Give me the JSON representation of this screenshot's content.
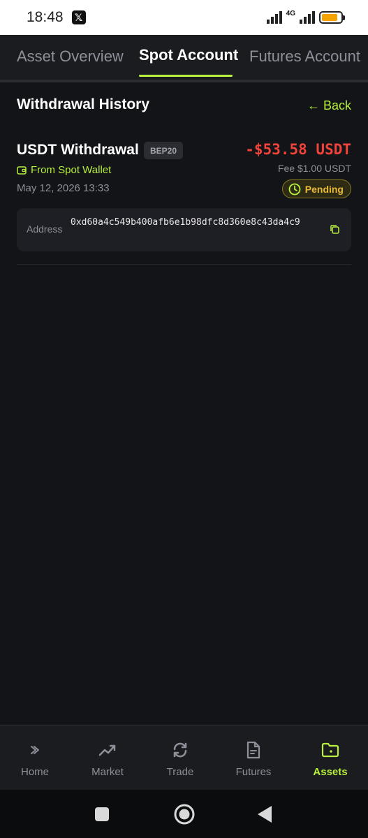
{
  "status_bar": {
    "time": "18:48",
    "app_badge": "𝕏",
    "network": "4G",
    "battery_level": 0.85
  },
  "tabs": [
    {
      "label": "Asset Overview",
      "active": false
    },
    {
      "label": "Spot Account",
      "active": true
    },
    {
      "label": "Futures Account",
      "active": false
    }
  ],
  "header": {
    "title": "Withdrawal History",
    "back_label": "← Back"
  },
  "transaction": {
    "title": "USDT Withdrawal",
    "network": "BEP20",
    "amount": "-$53.58 USDT",
    "source": "From Spot Wallet",
    "fee": "Fee $1.00 USDT",
    "date": "May 12, 2026 13:33",
    "status": "Pending",
    "address_label": "Address",
    "address": "0xd60a4c549b400afb6e1b98dfc8d360e8c43da4c9"
  },
  "bottom_nav": [
    {
      "label": "Home",
      "icon": "home-icon",
      "active": false
    },
    {
      "label": "Market",
      "icon": "trending-icon",
      "active": false
    },
    {
      "label": "Trade",
      "icon": "refresh-icon",
      "active": false
    },
    {
      "label": "Futures",
      "icon": "document-icon",
      "active": false
    },
    {
      "label": "Assets",
      "icon": "folder-icon",
      "active": true
    }
  ],
  "colors": {
    "accent": "#b8f03c",
    "negative": "#f0443b",
    "pending": "#e9b936",
    "background": "#131418"
  }
}
